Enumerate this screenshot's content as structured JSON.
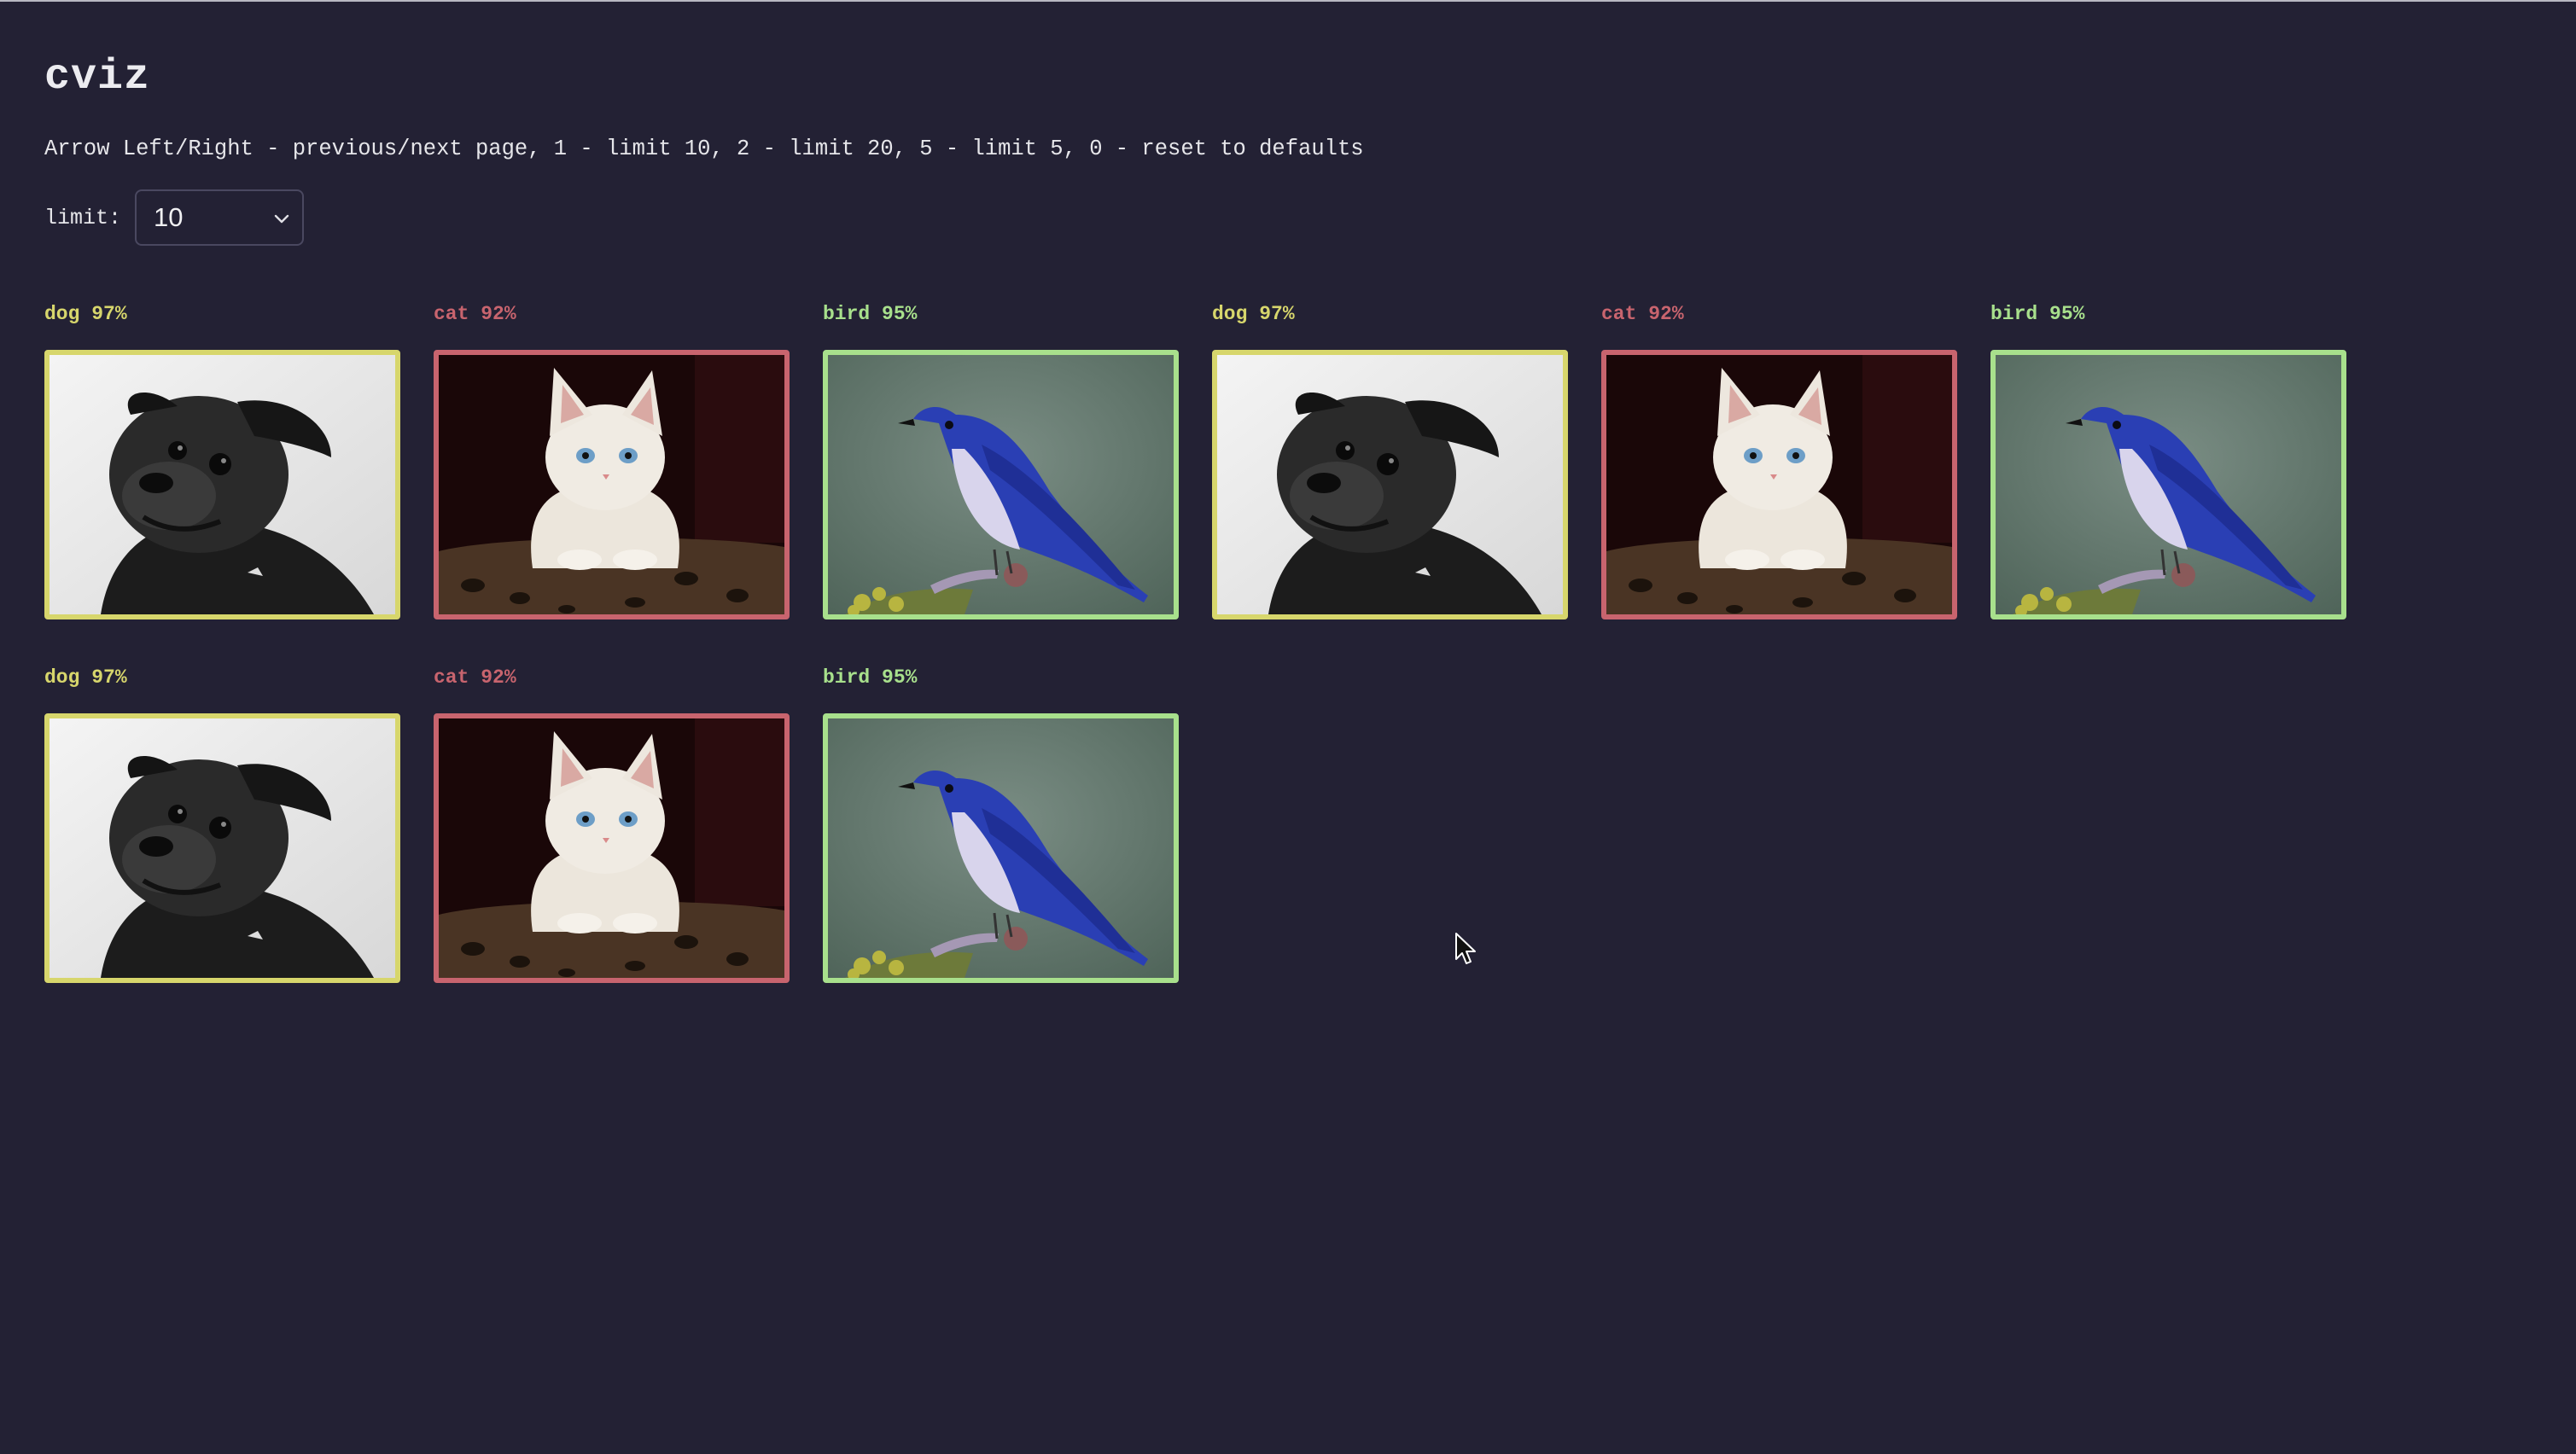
{
  "app": {
    "title": "cviz",
    "help": "Arrow Left/Right - previous/next page, 1 - limit 10, 2 - limit 20, 5 - limit 5, 0 - reset to defaults"
  },
  "limit": {
    "label": "limit:",
    "value": "10"
  },
  "colors": {
    "background": "#232134",
    "dog": "#d7d66c",
    "cat": "#c8646e",
    "bird": "#a8e08c"
  },
  "cards": [
    {
      "label": "dog 97%",
      "kind": "dog"
    },
    {
      "label": "cat 92%",
      "kind": "cat"
    },
    {
      "label": "bird 95%",
      "kind": "bird"
    },
    {
      "label": "dog 97%",
      "kind": "dog"
    },
    {
      "label": "cat 92%",
      "kind": "cat"
    },
    {
      "label": "bird 95%",
      "kind": "bird"
    },
    {
      "label": "dog 97%",
      "kind": "dog"
    },
    {
      "label": "cat 92%",
      "kind": "cat"
    },
    {
      "label": "bird 95%",
      "kind": "bird"
    }
  ]
}
